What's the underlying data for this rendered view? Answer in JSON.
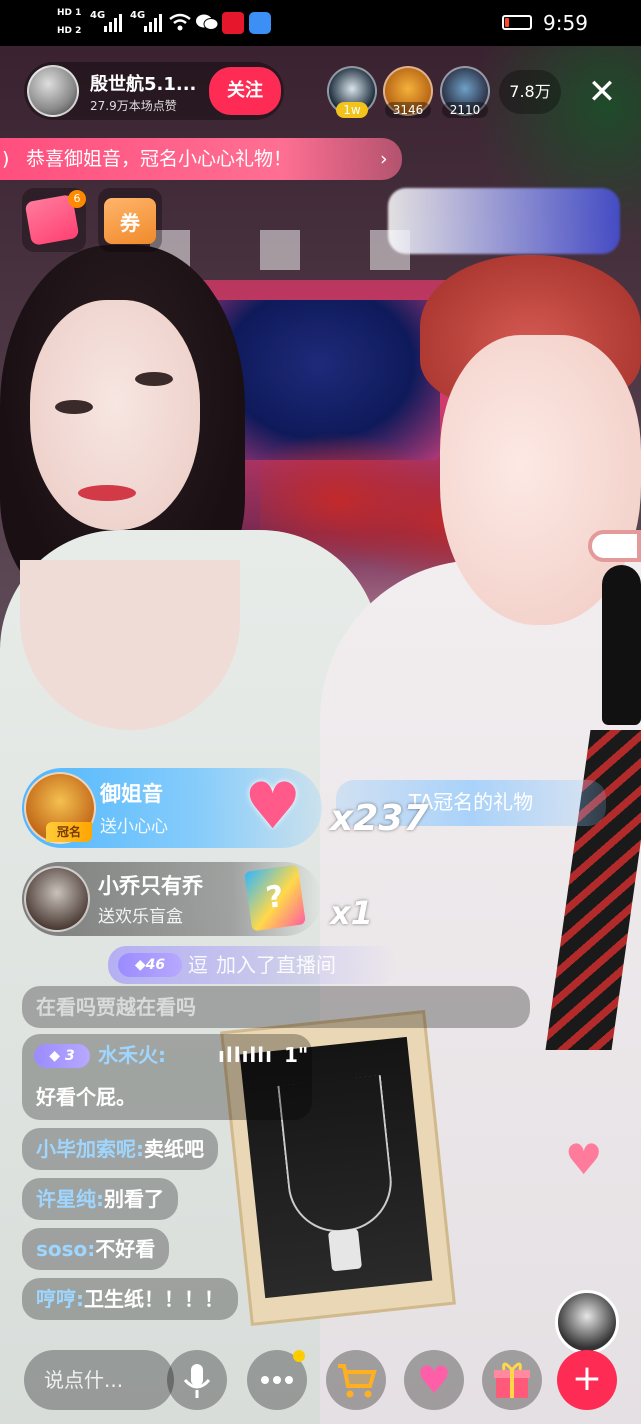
{
  "status_bar": {
    "hd1": "HD 1",
    "hd2": "HD 2",
    "net1": "4G",
    "net2": "4G",
    "time": "9:59",
    "battery_percent": 15
  },
  "host": {
    "name": "殷世航5.1...",
    "likes": "27.9万本场点赞",
    "follow_label": "关注"
  },
  "viewers": {
    "top": [
      {
        "badge": "1w",
        "badge_color": "#f2c31b"
      },
      {
        "badge": "3146",
        "badge_color": "rgba(0,0,0,0.35)"
      },
      {
        "badge": "2110",
        "badge_color": "rgba(0,0,0,0.35)"
      }
    ],
    "count": "7.8万"
  },
  "announcement": {
    "text": "恭喜御姐音，冠名小心心礼物！",
    "arrow": "›"
  },
  "activities": {
    "red_badge": "6",
    "coupon_label": "券"
  },
  "gifts": [
    {
      "user": "御姐音",
      "action": "送小心心",
      "tag": "冠名",
      "count": "x237",
      "icon": "heart-gift-icon"
    },
    {
      "user": "小乔只有乔",
      "action": "送欢乐盲盒",
      "count": "x1",
      "icon": "mystery-box-icon"
    }
  ],
  "ta_chip": "TA冠名的礼物",
  "join": {
    "level": "46",
    "user": "逗",
    "text": "加入了直播间"
  },
  "comments": [
    {
      "user": "",
      "text": "在看吗贾越在看吗"
    },
    {
      "level": "3",
      "user": "水禾火:",
      "voice_seconds": "1\"",
      "text": "好看个屁。"
    },
    {
      "user": "小毕加索呢:",
      "text": "卖纸吧"
    },
    {
      "user": "许星纯:",
      "text": "别看了"
    },
    {
      "user": "soso:",
      "text": "不好看"
    },
    {
      "user": "哼哼:",
      "text": "卫生纸！！！！"
    }
  ],
  "bottom_bar": {
    "placeholder": "说点什...",
    "plus": "+"
  }
}
